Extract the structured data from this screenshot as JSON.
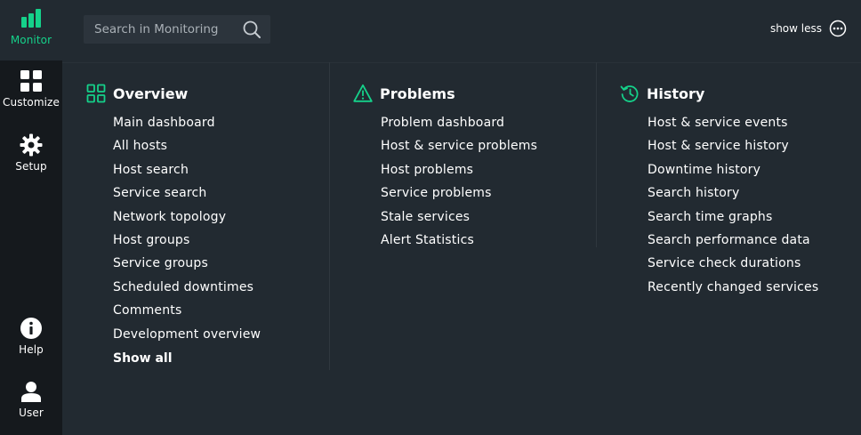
{
  "sidebar": {
    "items": [
      {
        "label": "Monitor",
        "icon": "bar-chart-icon"
      },
      {
        "label": "Customize",
        "icon": "grid-icon"
      },
      {
        "label": "Setup",
        "icon": "gear-icon"
      },
      {
        "label": "Help",
        "icon": "info-icon"
      },
      {
        "label": "User",
        "icon": "user-icon"
      }
    ]
  },
  "search": {
    "placeholder": "Search in Monitoring",
    "value": ""
  },
  "toggle": {
    "label": "show less",
    "icon": "more-circle-icon"
  },
  "columns": [
    {
      "title": "Overview",
      "icon": "overview-grid-icon",
      "items": [
        "Main dashboard",
        "All hosts",
        "Host search",
        "Service search",
        "Network topology",
        "Host groups",
        "Service groups",
        "Scheduled downtimes",
        "Comments",
        "Development overview"
      ],
      "show_all": "Show all"
    },
    {
      "title": "Problems",
      "icon": "warning-triangle-icon",
      "items": [
        "Problem dashboard",
        "Host & service problems",
        "Host problems",
        "Service problems",
        "Stale services",
        "Alert Statistics"
      ]
    },
    {
      "title": "History",
      "icon": "history-clock-icon",
      "items": [
        "Host & service events",
        "Host & service history",
        "Downtime history",
        "Search history",
        "Search time graphs",
        "Search performance data",
        "Service check durations",
        "Recently changed services"
      ]
    }
  ],
  "colors": {
    "accent": "#15d18a",
    "sidebar_bg": "#15191d",
    "main_bg": "#222a31",
    "search_bg": "#2c343c"
  }
}
